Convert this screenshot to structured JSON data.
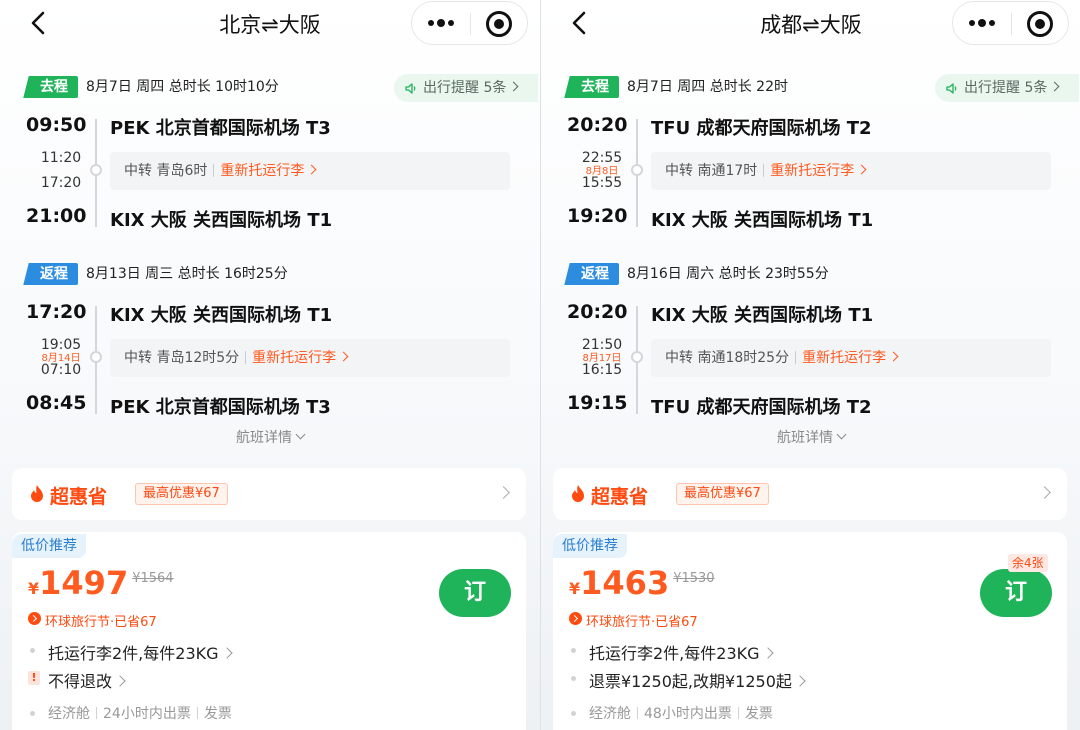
{
  "panels": [
    {
      "title": "北京⇌大阪",
      "outbound": {
        "tag": "去程",
        "info": "8月7日 周四  总时长 10时10分",
        "reminder": "出行提醒 5条",
        "depart_time": "09:50",
        "depart_airport": "PEK 北京首都国际机场 T3",
        "stop_arrive": "11:20",
        "stop_date": "",
        "stop_depart": "17:20",
        "transfer": "中转 青岛6时",
        "recheck": "重新托运行李",
        "arrive_time": "21:00",
        "arrive_airport": "KIX 大阪 关西国际机场 T1"
      },
      "inbound": {
        "tag": "返程",
        "info": "8月13日 周三  总时长 16时25分",
        "depart_time": "17:20",
        "depart_airport": "KIX 大阪 关西国际机场 T1",
        "stop_arrive": "19:05",
        "stop_date": "8月14日",
        "stop_depart": "07:10",
        "transfer": "中转 青岛12时5分",
        "recheck": "重新托运行李",
        "arrive_time": "08:45",
        "arrive_airport": "PEK 北京首都国际机场 T3"
      },
      "detail_link": "航班详情",
      "promo": {
        "logo": "超惠省",
        "badge": "最高优惠¥67"
      },
      "fare": {
        "tag": "低价推荐",
        "currency": "¥",
        "price": "1497",
        "original_price": "¥1564",
        "festival": "环球旅行节·已省67",
        "remaining": "",
        "book_label": "订",
        "baggage": "托运行李2件,每件23KG",
        "refund": "不得退改",
        "cabin": "经济舱",
        "ticketing": "24小时内出票",
        "invoice": "发票"
      }
    },
    {
      "title": "成都⇌大阪",
      "outbound": {
        "tag": "去程",
        "info": "8月7日 周四  总时长 22时",
        "reminder": "出行提醒 5条",
        "depart_time": "20:20",
        "depart_airport": "TFU 成都天府国际机场 T2",
        "stop_arrive": "22:55",
        "stop_date": "8月8日",
        "stop_depart": "15:55",
        "transfer": "中转 南通17时",
        "recheck": "重新托运行李",
        "arrive_time": "19:20",
        "arrive_airport": "KIX 大阪 关西国际机场 T1"
      },
      "inbound": {
        "tag": "返程",
        "info": "8月16日 周六  总时长 23时55分",
        "depart_time": "20:20",
        "depart_airport": "KIX 大阪 关西国际机场 T1",
        "stop_arrive": "21:50",
        "stop_date": "8月17日",
        "stop_depart": "16:15",
        "transfer": "中转 南通18时25分",
        "recheck": "重新托运行李",
        "arrive_time": "19:15",
        "arrive_airport": "TFU 成都天府国际机场 T2"
      },
      "detail_link": "航班详情",
      "promo": {
        "logo": "超惠省",
        "badge": "最高优惠¥67"
      },
      "fare": {
        "tag": "低价推荐",
        "currency": "¥",
        "price": "1463",
        "original_price": "¥1530",
        "festival": "环球旅行节·已省67",
        "remaining": "余4张",
        "book_label": "订",
        "baggage": "托运行李2件,每件23KG",
        "refund": "退票¥1250起,改期¥1250起",
        "cabin": "经济舱",
        "ticketing": "48小时内出票",
        "invoice": "发票"
      }
    }
  ],
  "colors": {
    "green": "#1fb35a",
    "blue": "#2c8de0",
    "orange": "#ff5a1f"
  }
}
